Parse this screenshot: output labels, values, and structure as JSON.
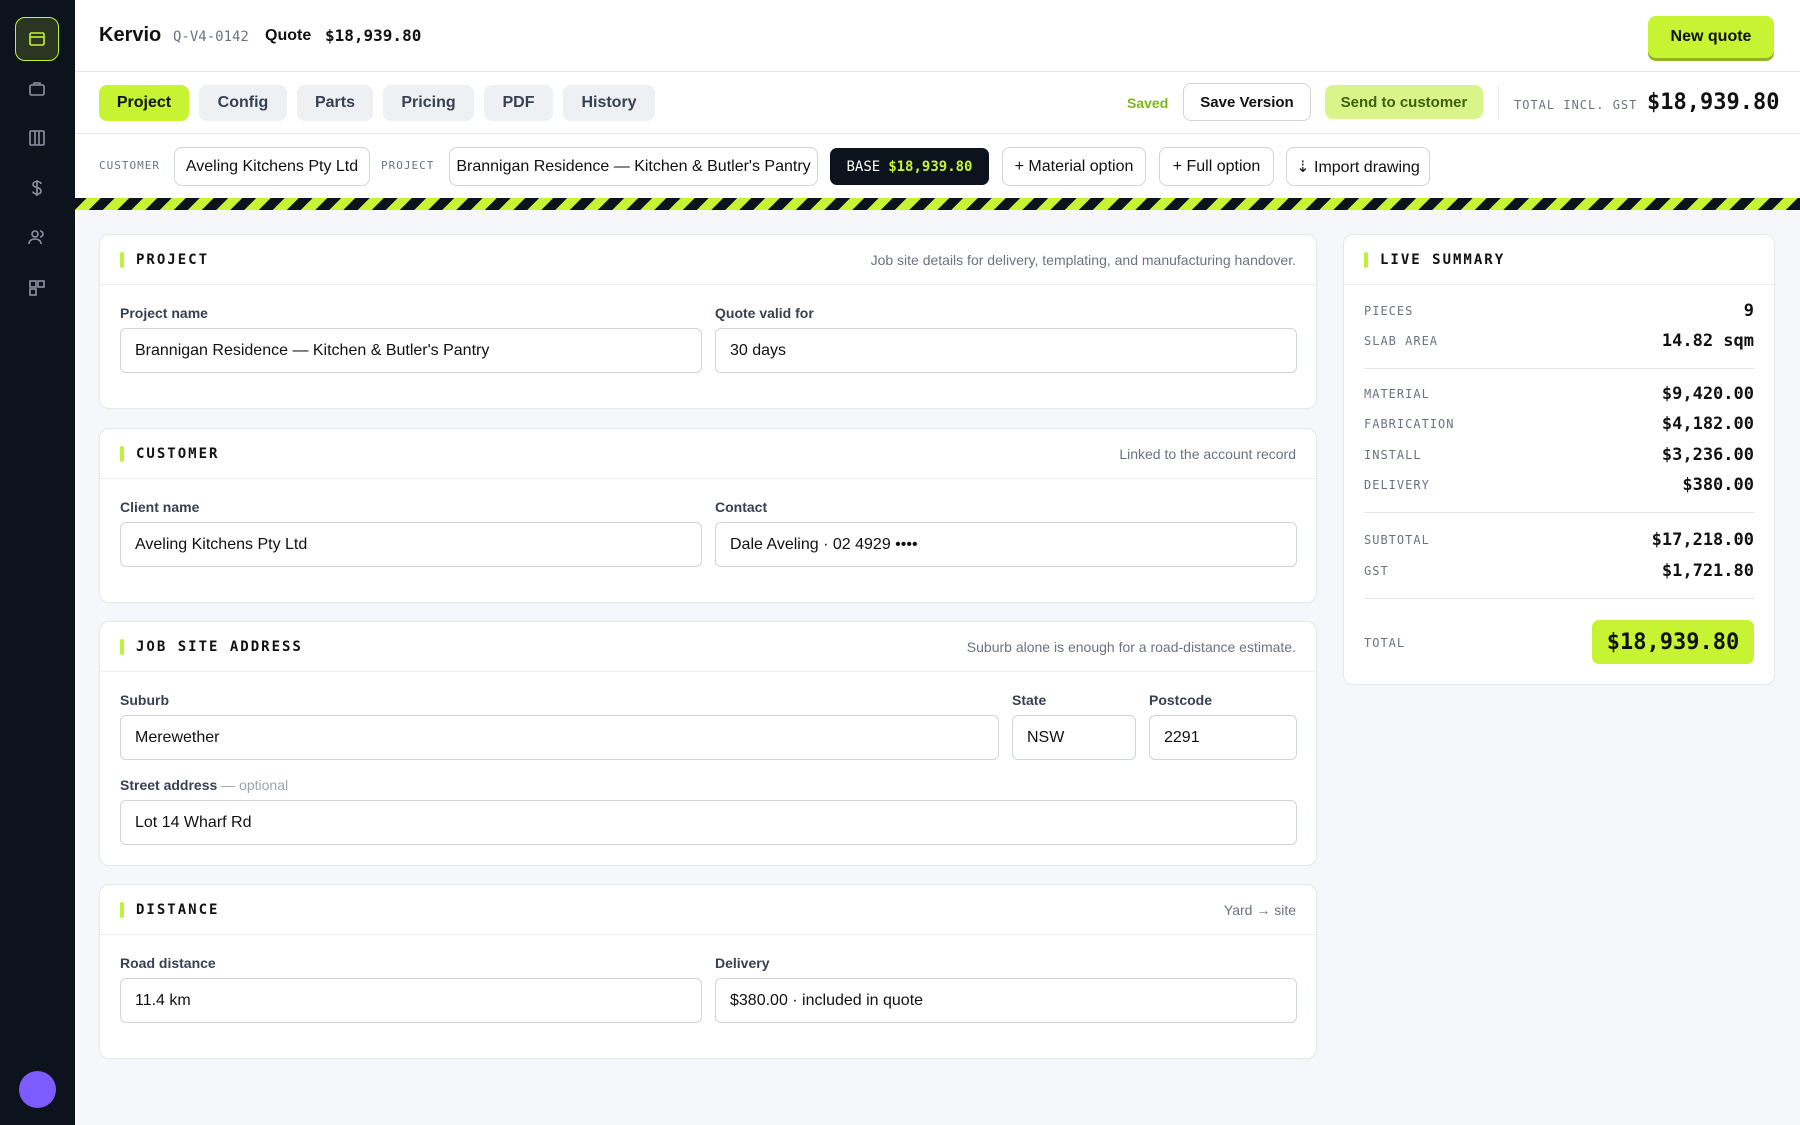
{
  "app": {
    "brand": "Kervio",
    "quote_id": "Q-V4-0142",
    "quote_label": "Quote",
    "quote_amount": "$18,939.80",
    "new_quote": "New quote"
  },
  "sidebar": {
    "icons": [
      "quotes-icon",
      "jobs-icon",
      "board-icon",
      "pricing-icon",
      "users-icon",
      "widgets-icon"
    ]
  },
  "tabs": [
    {
      "label": "Project",
      "active": true
    },
    {
      "label": "Config"
    },
    {
      "label": "Parts"
    },
    {
      "label": "Pricing"
    },
    {
      "label": "PDF"
    },
    {
      "label": "History"
    }
  ],
  "toolbar": {
    "saved": "Saved",
    "save_version": "Save Version",
    "send": "Send to customer",
    "total_label": "TOTAL INCL. GST",
    "total_value": "$18,939.80"
  },
  "context": {
    "customer_label": "CUSTOMER",
    "customer": "Aveling Kitchens Pty Ltd",
    "project_label": "PROJECT",
    "project": "Brannigan Residence — Kitchen & Butler's Pantry",
    "base_label": "BASE",
    "base_amount": "$18,939.80",
    "material_option": "+ Material option",
    "full_option": "+ Full option",
    "import_drawing": "⇣ Import drawing"
  },
  "project": {
    "title": "PROJECT",
    "note": "Job site details for delivery, templating, and manufacturing handover.",
    "name_label": "Project name",
    "name_value": "Brannigan Residence — Kitchen & Butler's Pantry",
    "valid_label": "Quote valid for",
    "valid_value": "30 days"
  },
  "customer": {
    "title": "CUSTOMER",
    "note": "Linked to the account record",
    "client_label": "Client name",
    "client_value": "Aveling Kitchens Pty Ltd",
    "contact_label": "Contact",
    "contact_value": "Dale Aveling · 02 4929 ••••"
  },
  "address": {
    "title": "JOB SITE ADDRESS",
    "note": "Suburb alone is enough for a road-distance estimate.",
    "suburb_label": "Suburb",
    "suburb_value": "Merewether",
    "state_label": "State",
    "state_value": "NSW",
    "postcode_label": "Postcode",
    "postcode_value": "2291",
    "street_label": "Street address",
    "street_optional": "— optional",
    "street_value": "Lot 14 Wharf Rd"
  },
  "distance": {
    "title": "DISTANCE",
    "note": "Yard → site",
    "road_label": "Road distance",
    "road_value": "11.4 km",
    "delivery_label": "Delivery",
    "delivery_value": "$380.00 · included in quote"
  },
  "summary": {
    "title": "LIVE SUMMARY",
    "pieces_label": "PIECES",
    "pieces": "9",
    "slab_label": "SLAB AREA",
    "slab": "14.82 sqm",
    "material_label": "MATERIAL",
    "material": "$9,420.00",
    "fabrication_label": "FABRICATION",
    "fabrication": "$4,182.00",
    "install_label": "INSTALL",
    "install": "$3,236.00",
    "delivery_label": "DELIVERY",
    "delivery": "$380.00",
    "subtotal_label": "SUBTOTAL",
    "subtotal": "$17,218.00",
    "gst_label": "GST",
    "gst": "$1,721.80",
    "total_label": "TOTAL",
    "total": "$18,939.80"
  },
  "colors": {
    "accent": "#c6f432",
    "sidebar": "#0d131c",
    "avatar": "#7c5cff"
  }
}
